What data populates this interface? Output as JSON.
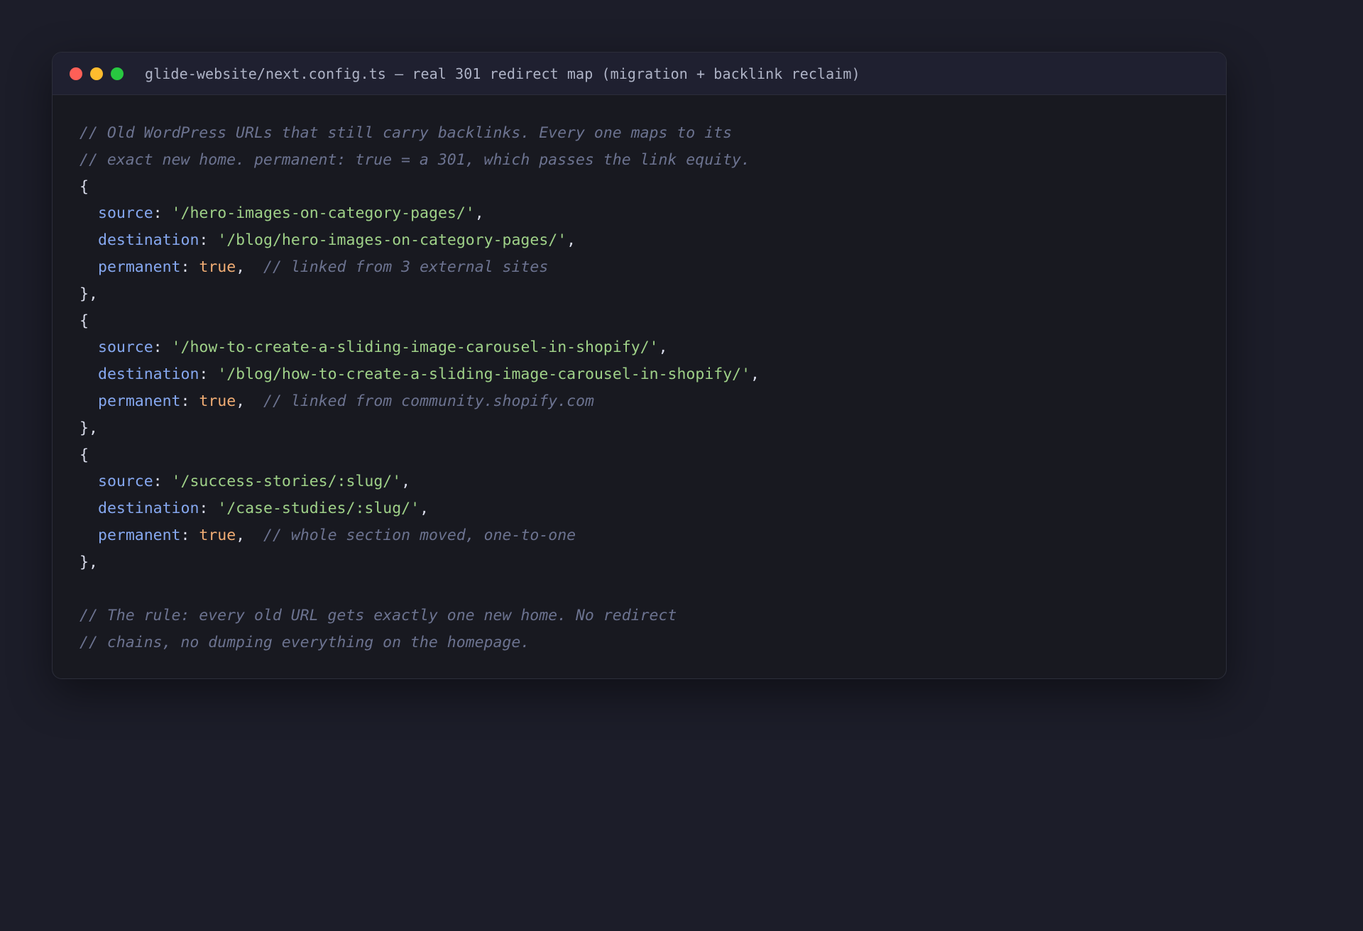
{
  "window": {
    "title": "glide-website/next.config.ts — real 301 redirect map (migration + backlink reclaim)",
    "controls": {
      "close_color": "#ff5f57",
      "minimize_color": "#febc2e",
      "maximize_color": "#28c840"
    }
  },
  "code": {
    "header_comment": [
      "// Old WordPress URLs that still carry backlinks. Every one maps to its",
      "// exact new home. permanent: true = a 301, which passes the link equity."
    ],
    "redirects": [
      {
        "source": "'/hero-images-on-category-pages/'",
        "destination": "'/blog/hero-images-on-category-pages/'",
        "permanent": "true",
        "comment": "// linked from 3 external sites"
      },
      {
        "source": "'/how-to-create-a-sliding-image-carousel-in-shopify/'",
        "destination": "'/blog/how-to-create-a-sliding-image-carousel-in-shopify/'",
        "permanent": "true",
        "comment": "// linked from community.shopify.com"
      },
      {
        "source": "'/success-stories/:slug/'",
        "destination": "'/case-studies/:slug/'",
        "permanent": "true",
        "comment": "// whole section moved, one-to-one"
      }
    ],
    "footer_comment": [
      "// The rule: every old URL gets exactly one new home. No redirect",
      "// chains, no dumping everything on the homepage."
    ]
  }
}
